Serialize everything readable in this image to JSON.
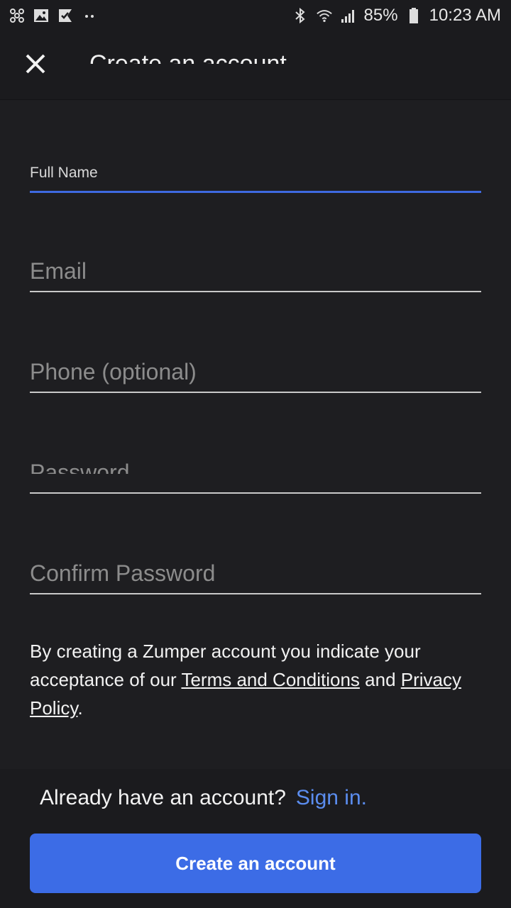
{
  "status_bar": {
    "left_icons": [
      "fan-icon",
      "gallery-icon",
      "check-app-icon",
      "dots-icon"
    ],
    "right_icons": [
      "bluetooth-icon",
      "wifi-icon",
      "signal-icon",
      "battery-icon"
    ],
    "battery": "85%",
    "time": "10:23 AM"
  },
  "app_bar": {
    "title": "Create an account",
    "close_icon": "close-icon"
  },
  "form": {
    "full_name": {
      "label": "Full Name",
      "value": ""
    },
    "email": {
      "placeholder": "Email"
    },
    "phone": {
      "placeholder": "Phone (optional)"
    },
    "password": {
      "placeholder": "Password"
    },
    "confirm_password": {
      "placeholder": "Confirm Password"
    }
  },
  "legal": {
    "prefix": "By creating a Zumper account you indicate your acceptance of our ",
    "terms_link": "Terms and Conditions",
    "middle": " and ",
    "privacy_link": "Privacy Policy",
    "suffix": "."
  },
  "footer": {
    "question": "Already have an account?",
    "signin_link": "Sign in.",
    "create_button": "Create an account"
  },
  "colors": {
    "background": "#1e1e21",
    "accent": "#3c6ce6",
    "link": "#5b8def"
  }
}
